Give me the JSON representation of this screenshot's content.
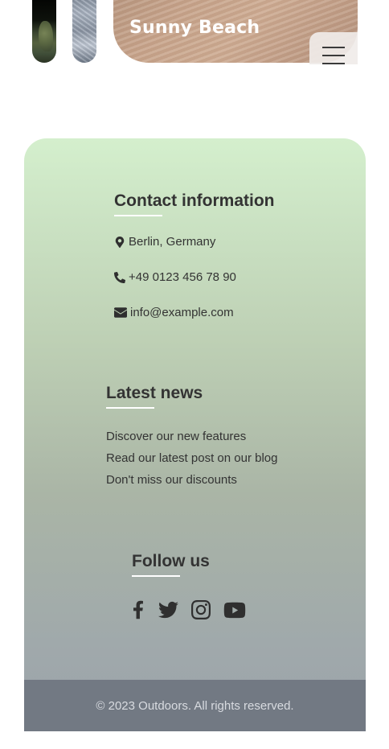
{
  "gallery": {
    "feature_title": "Sunny Beach",
    "thumbnails": [
      "forest-photo",
      "pebbles-photo"
    ],
    "feature_image": "sand-photo"
  },
  "menu": {
    "icon": "hamburger-menu-icon"
  },
  "footer": {
    "contact": {
      "title": "Contact information",
      "address": "Berlin, Germany",
      "phone": "+49 0123 456 78 90",
      "email": "info@example.com",
      "icons": [
        "map-marker-icon",
        "phone-icon",
        "envelope-icon"
      ]
    },
    "news": {
      "title": "Latest news",
      "items": [
        "Discover our new features",
        "Read our latest post on our blog",
        "Don't miss our discounts"
      ]
    },
    "follow": {
      "title": "Follow us",
      "icons": [
        "facebook-icon",
        "twitter-icon",
        "instagram-icon",
        "youtube-icon"
      ]
    },
    "copyright": "© 2023 Outdoors. All rights reserved."
  },
  "colors": {
    "footer_gradient_top": "#d4efcd",
    "footer_gradient_bottom": "#9ca3aa",
    "copyright_bar": "#727983",
    "title_underline": "#ffffff",
    "text": "#333333"
  }
}
